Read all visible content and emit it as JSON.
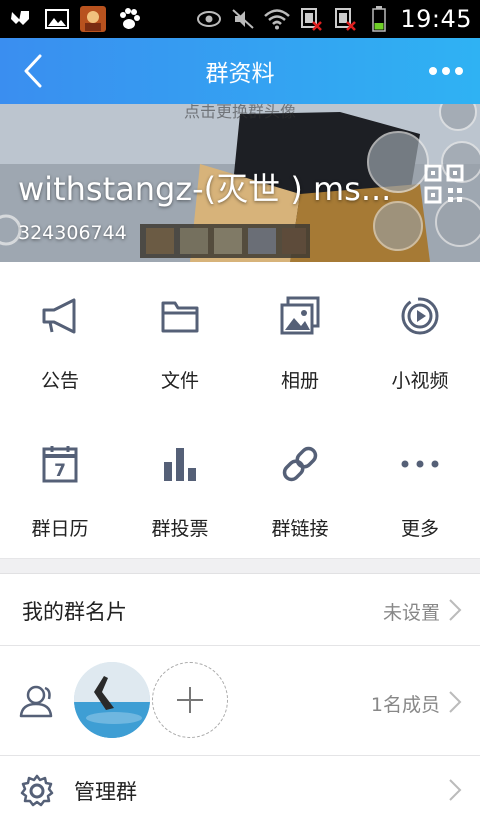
{
  "status_bar": {
    "time": "19:45"
  },
  "title_bar": {
    "title": "群资料"
  },
  "header": {
    "hint": "点击更换群头像",
    "group_name": "withstangz-(灭世 ) ms...",
    "group_id": "324306744"
  },
  "functions": [
    {
      "label": "公告",
      "icon": "megaphone-icon"
    },
    {
      "label": "文件",
      "icon": "folder-icon"
    },
    {
      "label": "相册",
      "icon": "album-icon"
    },
    {
      "label": "小视频",
      "icon": "video-play-icon"
    },
    {
      "label": "群日历",
      "icon": "calendar-icon"
    },
    {
      "label": "群投票",
      "icon": "vote-chart-icon"
    },
    {
      "label": "群链接",
      "icon": "link-icon"
    },
    {
      "label": "更多",
      "icon": "more-dots-icon"
    }
  ],
  "calendar_day": "7",
  "card_row": {
    "label": "我的群名片",
    "value": "未设置"
  },
  "members_row": {
    "count": "1名成员"
  },
  "manage_row": {
    "label": "管理群"
  },
  "colors": {
    "accent": "#3a8ef0",
    "icon": "#556077"
  }
}
